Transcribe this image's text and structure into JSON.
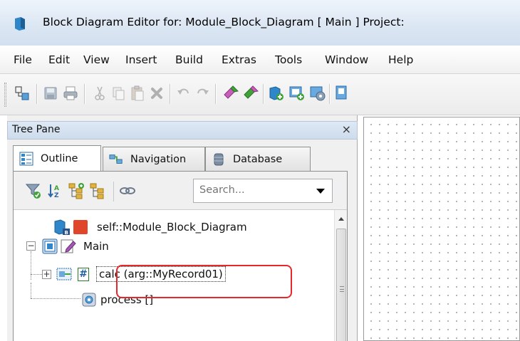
{
  "window": {
    "title": "Block Diagram Editor for: Module_Block_Diagram [ Main ] Project:"
  },
  "menu": [
    "File",
    "Edit",
    "View",
    "Insert",
    "Build",
    "Extras",
    "Tools",
    "Window",
    "Help"
  ],
  "toolbar": {
    "icons": [
      "grip",
      "select-icon",
      "save-icon",
      "print-icon",
      "cut-icon",
      "copy-icon",
      "paste-icon",
      "delete-icon",
      "undo-icon",
      "redo-icon",
      "build-icon",
      "run-icon",
      "insert-block-icon",
      "insert-port-icon",
      "block-settings-icon",
      "block-view-icon"
    ]
  },
  "tree_pane": {
    "title": "Tree Pane",
    "close_glyph": "×",
    "tabs": [
      {
        "label": "Outline",
        "active": true
      },
      {
        "label": "Navigation",
        "active": false
      },
      {
        "label": "Database",
        "active": false
      }
    ],
    "search": {
      "placeholder": "Search...",
      "value": ""
    },
    "tree": [
      {
        "label": "self::Module_Block_Diagram",
        "level": 0
      },
      {
        "label": "Main",
        "level": 0,
        "expanded": true
      },
      {
        "label": "calc (arg::MyRecord01)",
        "level": 1,
        "expanded": false,
        "highlighted": true
      },
      {
        "label": "process []",
        "level": 1
      }
    ]
  },
  "colors": {
    "highlight": "#e8272b",
    "title_bar": "#dbe6f3"
  }
}
